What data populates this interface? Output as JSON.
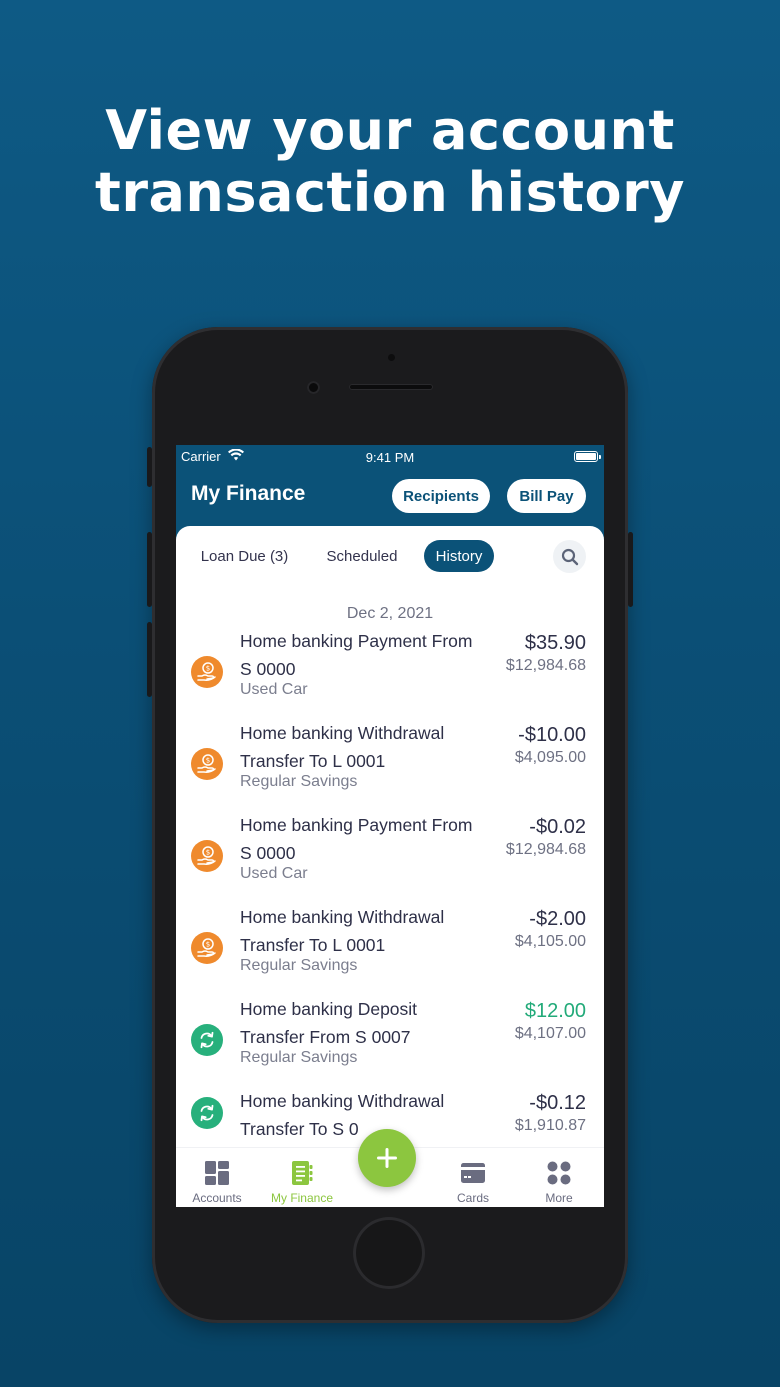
{
  "headline": {
    "line1": "View your account",
    "line2": "transaction history"
  },
  "status_bar": {
    "carrier": "Carrier",
    "time": "9:41 PM"
  },
  "nav": {
    "title": "My Finance",
    "recipients_label": "Recipients",
    "billpay_label": "Bill Pay"
  },
  "tabs": {
    "loan_due": "Loan Due (3)",
    "scheduled": "Scheduled",
    "history": "History",
    "active": "History"
  },
  "date_header": "Dec 2, 2021",
  "transactions": [
    {
      "line1": "Home banking Payment From",
      "line2": "S 0000",
      "category": "Used Car",
      "amount": "$35.90",
      "balance": "$12,984.68",
      "icon": "hand-dollar-icon",
      "icon_color": "#ef8a2d"
    },
    {
      "line1": "Home banking Withdrawal",
      "line2": "Transfer To L 0001",
      "category": "Regular Savings",
      "amount": "-$10.00",
      "balance": "$4,095.00",
      "icon": "hand-dollar-icon",
      "icon_color": "#ef8a2d"
    },
    {
      "line1": "Home banking Payment From",
      "line2": "S 0000",
      "category": "Used Car",
      "amount": "-$0.02",
      "balance": "$12,984.68",
      "icon": "hand-dollar-icon",
      "icon_color": "#ef8a2d"
    },
    {
      "line1": "Home banking Withdrawal",
      "line2": "Transfer To L 0001",
      "category": "Regular Savings",
      "amount": "-$2.00",
      "balance": "$4,105.00",
      "icon": "hand-dollar-icon",
      "icon_color": "#ef8a2d"
    },
    {
      "line1": "Home banking Deposit",
      "line2": "Transfer From S 0007",
      "category": "Regular Savings",
      "amount": "$12.00",
      "balance": "$4,107.00",
      "icon": "transfer-arrows-icon",
      "icon_color": "#27b07c"
    },
    {
      "line1": "Home banking Withdrawal",
      "line2": "Transfer To S 0",
      "category": "",
      "amount": "-$0.12",
      "balance": "$1,910.87",
      "icon": "transfer-arrows-icon",
      "icon_color": "#27b07c"
    }
  ],
  "tabbar": {
    "accounts": "Accounts",
    "my_finance": "My Finance",
    "cards": "Cards",
    "more": "More",
    "active": "My Finance"
  },
  "colors": {
    "background": "#0b5278",
    "accent_green": "#8cc63f",
    "positive_amount": "#22aa79",
    "payment_icon": "#ef8a2d",
    "transfer_icon": "#27b07c"
  }
}
